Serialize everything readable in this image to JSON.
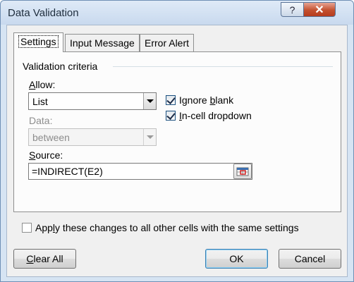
{
  "window": {
    "title": "Data Validation",
    "help_label": "?",
    "close_label": "✕"
  },
  "tabs": [
    {
      "label": "Settings",
      "active": true
    },
    {
      "label": "Input Message",
      "active": false
    },
    {
      "label": "Error Alert",
      "active": false
    }
  ],
  "validation_criteria": {
    "group_title": "Validation criteria",
    "allow": {
      "label_underlined": "A",
      "label_rest": "llow:",
      "value": "List"
    },
    "data": {
      "label": "Data:",
      "value": "between",
      "disabled": true
    },
    "ignore_blank": {
      "label_pre": "Ignore ",
      "label_underlined": "b",
      "label_rest": "lank",
      "checked": true
    },
    "in_cell_dropdown": {
      "label_underlined": "I",
      "label_rest": "n-cell dropdown",
      "checked": true
    },
    "source": {
      "label_underlined": "S",
      "label_rest": "ource:",
      "value": "=INDIRECT(E2)"
    }
  },
  "apply_all": {
    "label_pre": "App",
    "label_underlined": "l",
    "label_rest": "y these changes to all other cells with the same settings",
    "checked": false
  },
  "buttons": {
    "clear_all": {
      "label_underlined": "C",
      "label_rest": "lear All"
    },
    "ok": "OK",
    "cancel": "Cancel"
  },
  "colors": {
    "frame": "#d6e4f3",
    "close_button": "#c4502f",
    "default_button_border": "#3c7fb1"
  }
}
